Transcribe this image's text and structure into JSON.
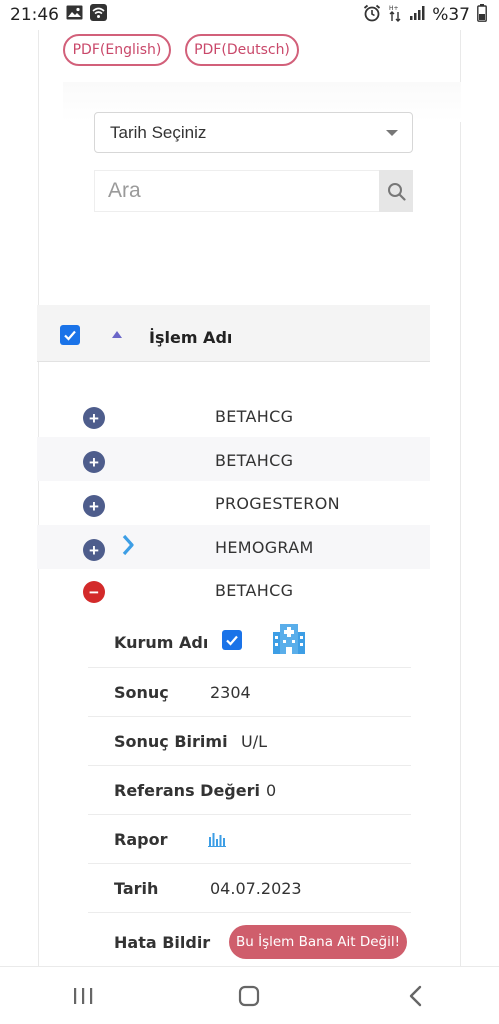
{
  "status_bar": {
    "time": "21:46",
    "battery": "%37"
  },
  "pdf_buttons": {
    "english": "PDF(English)",
    "deutsch": "PDF(Deutsch)"
  },
  "filters": {
    "date_select": "Tarih Seçiniz",
    "search_placeholder": "Ara"
  },
  "table": {
    "header": "İşlem Adı",
    "rows": [
      {
        "label": "BETAHCG",
        "expanded": false
      },
      {
        "label": "BETAHCG",
        "expanded": false
      },
      {
        "label": "PROGESTERON",
        "expanded": false
      },
      {
        "label": "HEMOGRAM",
        "expanded": false
      },
      {
        "label": "BETAHCG",
        "expanded": true
      }
    ]
  },
  "detail": {
    "institution_label": "Kurum Adı",
    "result_label": "Sonuç",
    "result_value": "2304",
    "unit_label": "Sonuç Birimi",
    "unit_value": "U/L",
    "reference_label": "Referans Değeri",
    "reference_value": "0",
    "report_label": "Rapor",
    "date_label": "Tarih",
    "date_value": "04.07.2023",
    "error_label": "Hata Bildir",
    "error_button": "Bu İşlem Bana Ait Değil!"
  },
  "colors": {
    "accent_pink": "#c9486a",
    "checkbox_blue": "#1a73e8",
    "plus_button": "#4e5d8c",
    "minus_button": "#d32a2a",
    "error_button": "#cf5e6c",
    "icon_blue": "#3d9ee5"
  },
  "icons": {
    "status_left": [
      "image-icon",
      "wifi-calling-icon"
    ],
    "status_right": [
      "alarm-icon",
      "data-arrows-icon",
      "signal-icon"
    ],
    "institution": "hospital-building-icon",
    "report": "bar-chart-icon",
    "nav": [
      "recent-apps-icon",
      "home-icon",
      "back-icon"
    ]
  }
}
